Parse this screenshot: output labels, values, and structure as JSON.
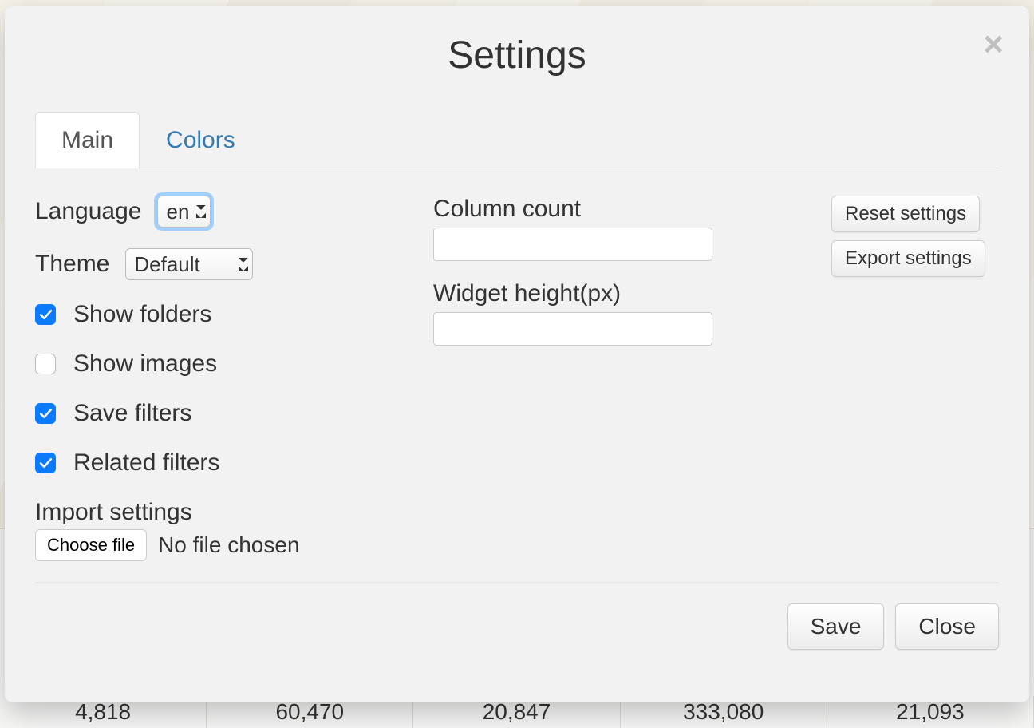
{
  "modal": {
    "title": "Settings",
    "tabs": {
      "main": "Main",
      "colors": "Colors"
    }
  },
  "main": {
    "language_label": "Language",
    "language_value": "en",
    "theme_label": "Theme",
    "theme_value": "Default",
    "show_folders_label": "Show folders",
    "show_folders_checked": true,
    "show_images_label": "Show images",
    "show_images_checked": false,
    "save_filters_label": "Save filters",
    "save_filters_checked": true,
    "related_filters_label": "Related filters",
    "related_filters_checked": true,
    "import_label": "Import settings",
    "choose_file_label": "Choose file",
    "file_status": "No file chosen",
    "column_count_label": "Column count",
    "column_count_value": "",
    "widget_height_label": "Widget height(px)",
    "widget_height_value": ""
  },
  "actions": {
    "reset": "Reset settings",
    "export": "Export settings",
    "save": "Save",
    "close": "Close"
  },
  "background_values": [
    "4,818",
    "60,470",
    "20,847",
    "333,080",
    "21,093"
  ]
}
